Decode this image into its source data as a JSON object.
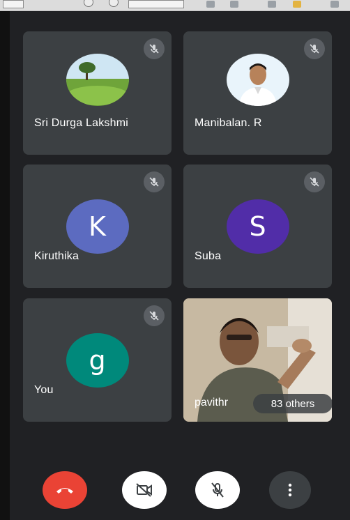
{
  "participants": [
    {
      "name": "Sri Durga Lakshmi",
      "avatar_type": "photo",
      "photo_icon": "landscape-photo",
      "muted": true
    },
    {
      "name": "Manibalan. R",
      "avatar_type": "photo",
      "photo_icon": "person-photo",
      "muted": true
    },
    {
      "name": "Kiruthika",
      "avatar_type": "letter",
      "initial": "K",
      "color": "#5c6bc0",
      "muted": true
    },
    {
      "name": "Suba",
      "avatar_type": "letter",
      "initial": "S",
      "color": "#512da8",
      "muted": true
    },
    {
      "name": "You",
      "avatar_type": "letter",
      "initial": "g",
      "color": "#00897b",
      "muted": true
    }
  ],
  "video_tile": {
    "name_visible": "pavithr",
    "others_label": "83 others"
  },
  "controls": {
    "end_call_icon": "phone-hangup-icon",
    "camera_icon": "camera-off-icon",
    "mic_icon": "mic-off-icon",
    "more_icon": "more-vert-icon"
  },
  "colors": {
    "background": "#202124",
    "tile": "#3c4043",
    "end_call": "#ea4335"
  }
}
